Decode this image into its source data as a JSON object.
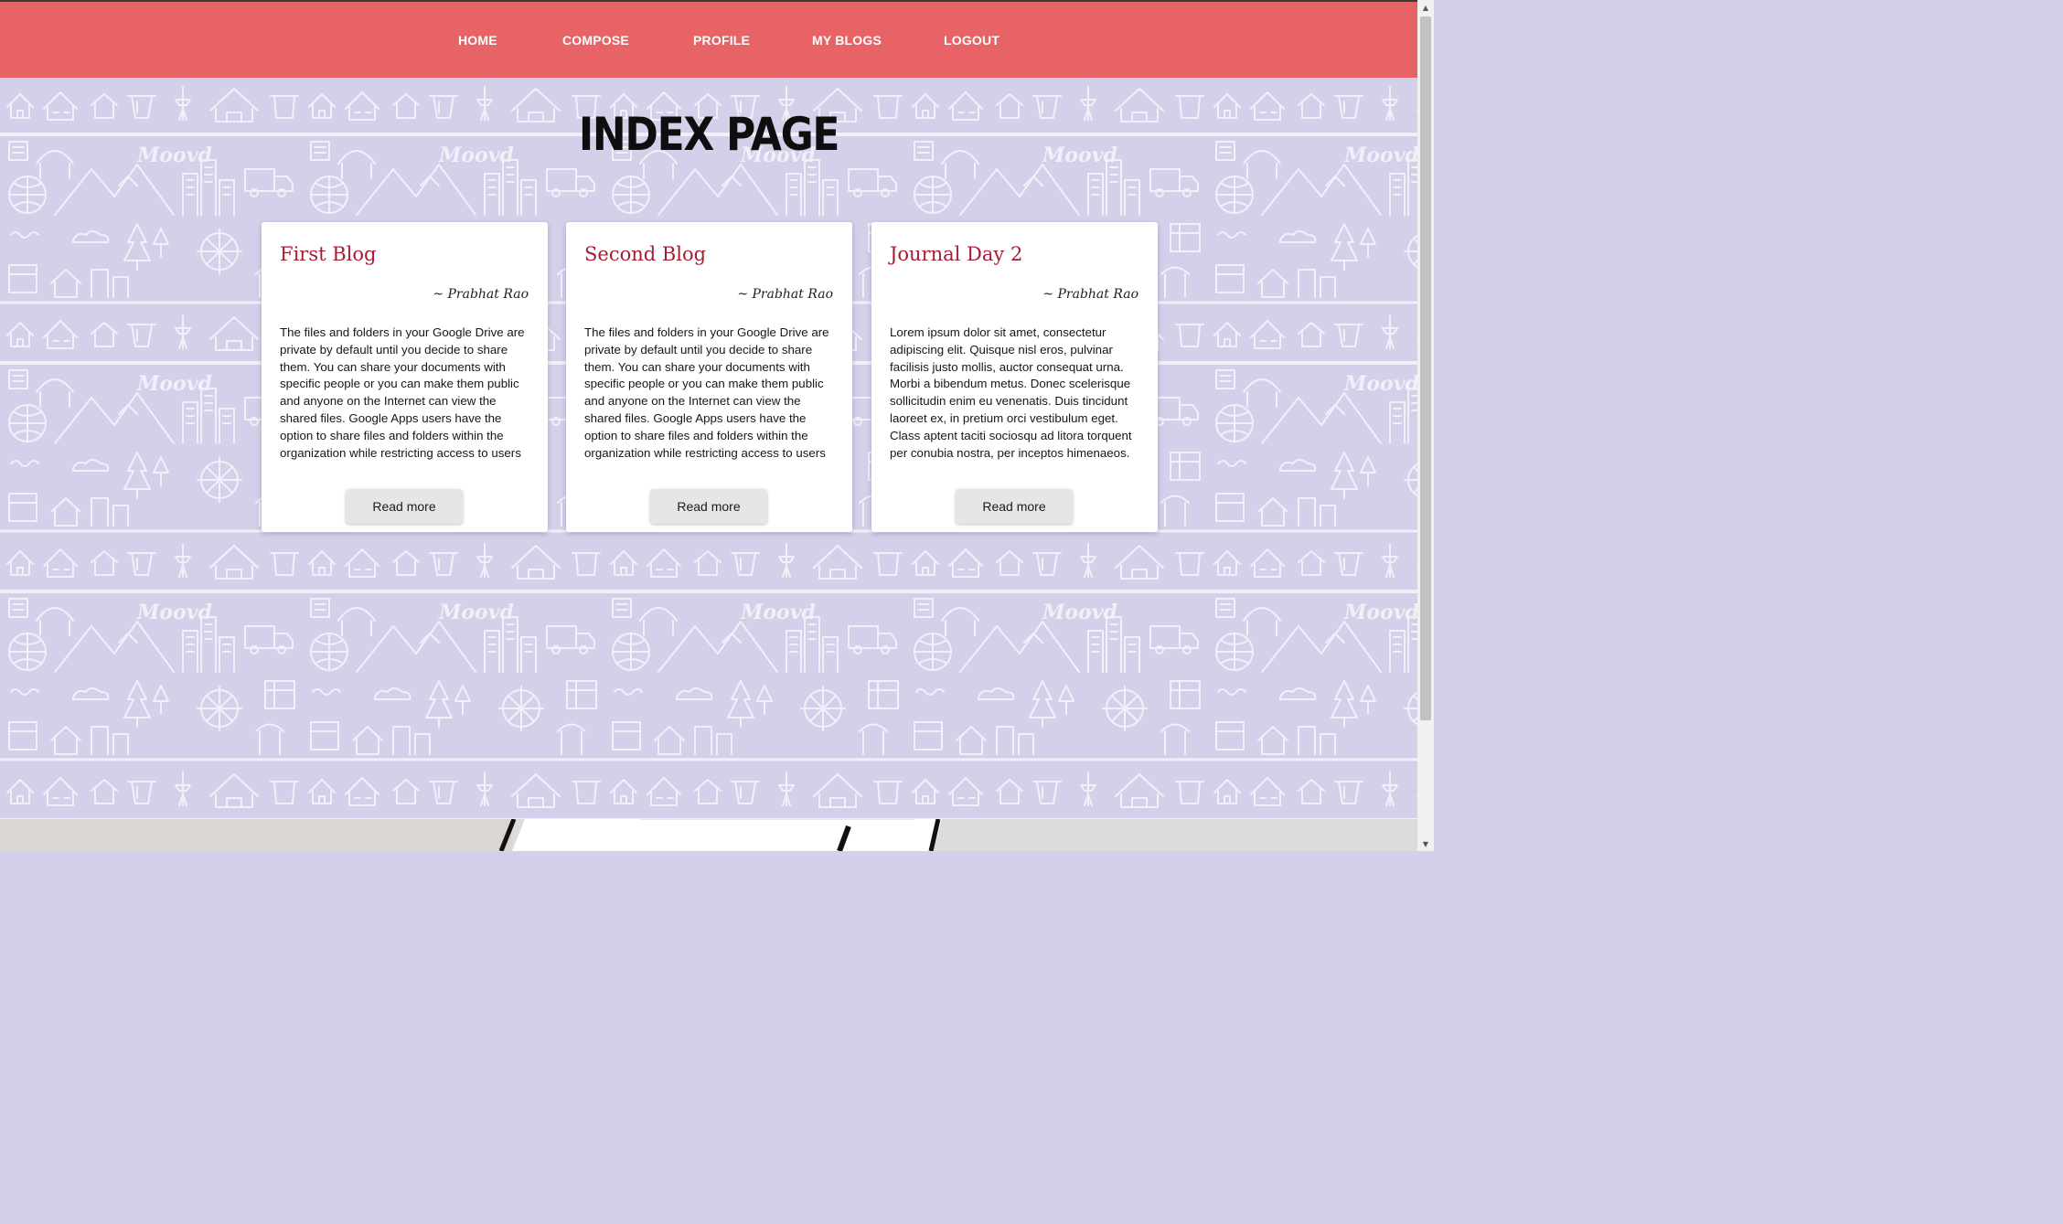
{
  "nav": {
    "items": [
      {
        "label": "HOME"
      },
      {
        "label": "COMPOSE"
      },
      {
        "label": "PROFILE"
      },
      {
        "label": "MY BLOGS"
      },
      {
        "label": "LOGOUT"
      }
    ]
  },
  "background": {
    "watermark_text": "Moovd"
  },
  "page": {
    "title": "INDEX PAGE"
  },
  "cards": [
    {
      "title": "First Blog",
      "author": "~ Prabhat Rao",
      "body": "The files and folders in your Google Drive are private by default until you decide to share them. You can share your documents with specific people or you can make them public and anyone on the Internet can view the shared files. Google Apps users have the option to share files and folders within the organization while restricting access to users outside the domain. You can set...",
      "button_label": "Read more"
    },
    {
      "title": "Second Blog",
      "author": "~ Prabhat Rao",
      "body": "The files and folders in your Google Drive are private by default until you decide to share them. You can share your documents with specific people or you can make them public and anyone on the Internet can view the shared files. Google Apps users have the option to share files and folders within the organization while restricting access to users outside the domain. You can set...",
      "button_label": "Read more"
    },
    {
      "title": "Journal Day 2",
      "author": "~ Prabhat Rao",
      "body": "Lorem ipsum dolor sit amet, consectetur adipiscing elit. Quisque nisl eros, pulvinar facilisis justo mollis, auctor consequat urna. Morbi a bibendum metus. Donec scelerisque sollicitudin enim eu venenatis. Duis tincidunt laoreet ex, in pretium orci vestibulum eget. Class aptent taciti sociosqu ad litora torquent per conubia nostra, per inceptos himenaeos. Duis...",
      "button_label": "Read more"
    }
  ],
  "colors": {
    "navbar": "#e76365",
    "background": "#d4d0ea",
    "card_title": "#a51d33",
    "button": "#e6e6e6"
  }
}
